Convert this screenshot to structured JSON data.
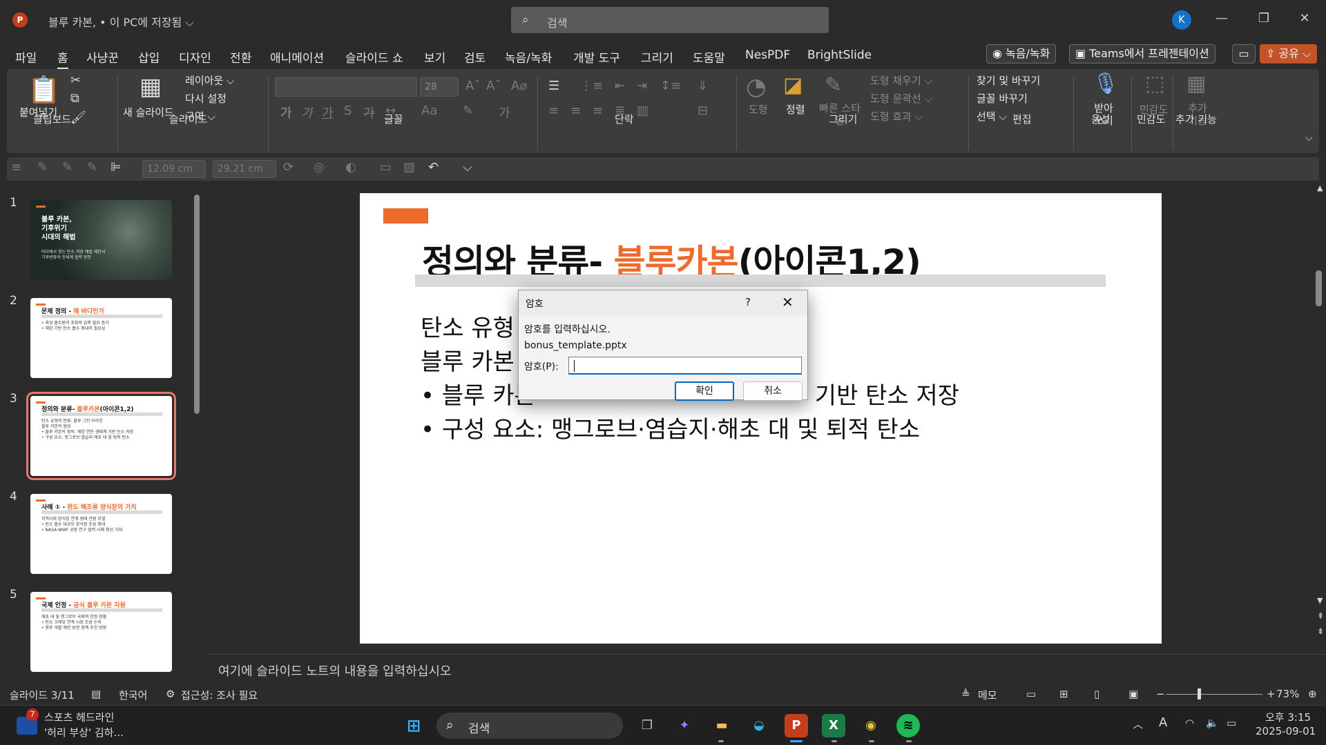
{
  "titlebar": {
    "app_icon": "P",
    "doc_title": "블루 카본, • 이 PC에 저장됨 ⌵",
    "search_placeholder": "검색",
    "avatar": "K"
  },
  "menu": {
    "items": [
      "파일",
      "홈",
      "사냥꾼",
      "삽입",
      "디자인",
      "전환",
      "애니메이션",
      "슬라이드 쇼",
      "보기",
      "검토",
      "녹음/녹화",
      "개발 도구",
      "그리기",
      "도움말",
      "NesPDF",
      "BrightSlide"
    ],
    "active": "홈",
    "record_label": "◉ 녹음/녹화",
    "teams_label": "Teams에서 프레젠테이션",
    "share_label": "공유"
  },
  "ribbon": {
    "clipboard": {
      "paste": "붙여넣기",
      "group": "클립보드"
    },
    "slides": {
      "new_slide": "새 슬라이드",
      "layout": "레이아웃 ⌵",
      "reset": "다시 설정",
      "section": "구역 ⌵",
      "group": "슬라이드"
    },
    "font": {
      "size": "28",
      "group": "글꼴"
    },
    "paragraph": {
      "group": "단락"
    },
    "drawing": {
      "shapes": "도형",
      "arrange": "정렬",
      "quick_styles": "빠른 스타일",
      "fill": "도형 채우기 ⌵",
      "outline": "도형 윤곽선 ⌵",
      "effects": "도형 효과 ⌵",
      "group": "그리기"
    },
    "editing": {
      "find": "찾기 및 바꾸기",
      "replace": "글꼴 바꾸기",
      "select": "선택 ⌵",
      "group": "편집"
    },
    "voice": {
      "dictate": "받아 쓰기",
      "group": "음성"
    },
    "sensitivity": {
      "label": "민감도",
      "group": "민감도"
    },
    "addins": {
      "label": "추가 기능",
      "group": "추가 기능"
    }
  },
  "qat": {
    "width": "12.09 cm",
    "height": "29.21 cm"
  },
  "thumbnails": [
    {
      "num": "1",
      "title": "블루 카본,\n기후위기\n시대의 해법",
      "body": "바다에서 찾는 탄소 저장 해법 제안서\n기후변화와 전세계 협력 방안",
      "dark": true
    },
    {
      "num": "2",
      "title_pre": "문제 정의 - ",
      "title_hl": "왜 바다인가",
      "body": "• 육상 흡수원의 포화와 감축 필요 증가\n• 해양 기반 탄소 흡수 확대의 필요성"
    },
    {
      "num": "3",
      "title_pre": "정의와 분류- ",
      "title_hl": "블루카본",
      "title_post": "(아이콘1,2)",
      "body": "탄소 유형의 분류: 블루·그린·브라운\n블루 카본의 범위\n• 블루 카본의 정의: 해양 연안 생태계 기반 탄소 저장\n• 구성 요소: 맹그로브·염습지·해초 대 및 퇴적 탄소",
      "selected": true
    },
    {
      "num": "4",
      "title_pre": "사례 ① - ",
      "title_hl": "완도 해조류 양식장의 가치",
      "body": "지역사회 양식업 연계 생태 관광 모델\n• 탄소 흡수 대규모 양식장 조성 확대\n• NASA·WWF 공동 연구 협력 사례 확산 기대"
    },
    {
      "num": "5",
      "title_pre": "국제 인정 - ",
      "title_hl": "공식 블루 카본 자원",
      "body": "해초 대 및 맹그로브 국제적 인정 현황\n• 탄소 크레딧 연계 시장 조성 논의\n• 향후 개별 해안 보전 정책 추진 방향"
    }
  ],
  "slide": {
    "title_pre": "정의와 분류- ",
    "title_hl": "블루카본",
    "title_post": "(아이콘1,2)",
    "line1": "탄소 유형",
    "line2": "블루 카본",
    "line3_pre": "• 블루 카본",
    "line3_post": "기반 탄소 저장",
    "line4": "• 구성 요소: 맹그로브·염습지·해초 대 및 퇴적 탄소"
  },
  "dialog": {
    "title": "암호",
    "help": "?",
    "prompt": "암호를 입력하십시오.",
    "filename": "bonus_template.pptx",
    "field_label": "암호(P):",
    "password_value": "",
    "ok": "확인",
    "cancel": "취소"
  },
  "notes": {
    "placeholder": "여기에 슬라이드 노트의 내용을 입력하십시오"
  },
  "status": {
    "slide_pos": "슬라이드 3/11",
    "language": "한국어",
    "accessibility": "접근성: 조사 필요",
    "notes_btn": "메모",
    "zoom": "73%"
  },
  "taskbar": {
    "news_count": "7",
    "news_title": "스포츠 헤드라인",
    "news_sub": "'허리 부상' 김하...",
    "search_placeholder": "검색",
    "time": "오후 3:15",
    "date": "2025-09-01"
  },
  "colors": {
    "accent": "#ec6b2d",
    "ppt": "#c43e1c",
    "dialog_focus": "#0067c0"
  }
}
